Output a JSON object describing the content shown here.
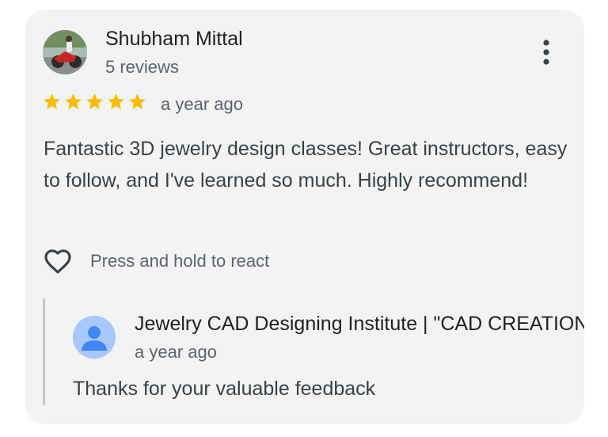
{
  "review": {
    "author_name": "Shubham Mittal",
    "author_reviews": "5 reviews",
    "rating": 5,
    "rating_max": 5,
    "time": "a year ago",
    "text": "Fantastic 3D jewelry design classes! Great instructors, easy to follow, and I've learned so much. Highly recommend!",
    "react_label": "Press and hold to react"
  },
  "reply": {
    "owner_name": "Jewelry CAD Designing Institute | \"CAD CREATIONS\"",
    "time": "a year ago",
    "text": "Thanks for your valuable feedback"
  },
  "icons": {
    "menu": "more-vert-icon",
    "star": "star-icon",
    "react": "heart-outline-icon",
    "owner_avatar": "person-icon"
  },
  "colors": {
    "card_background": "#f1f3f4",
    "star": "#fbbc04",
    "primary_text": "#202124",
    "body_text": "#3c4043",
    "secondary_text": "#5f6368",
    "owner_avatar": "#a8c7fa",
    "owner_avatar_glyph": "#4285f4"
  }
}
